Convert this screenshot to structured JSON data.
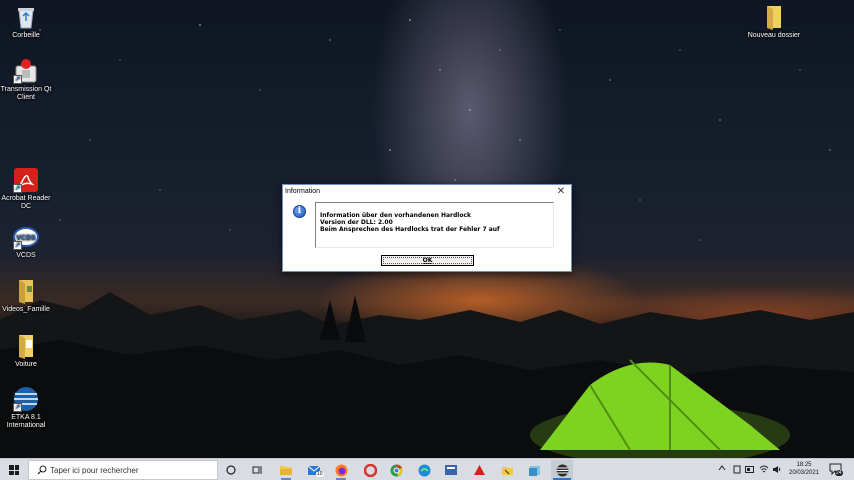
{
  "desktop": {
    "icons": [
      {
        "label": "Corbeille"
      },
      {
        "label": "Transmission Qt Client"
      },
      {
        "label": "Acrobat Reader DC"
      },
      {
        "label": "VCDS"
      },
      {
        "label": "Videos_Famille"
      },
      {
        "label": "Voiture"
      },
      {
        "label": "ETKA 8.1 International"
      },
      {
        "label": "Nouveau dossier"
      }
    ]
  },
  "dialog": {
    "title": "Information",
    "close_glyph": "✕",
    "info_glyph": "i",
    "message_lines": [
      "Information über den vorhandenen Hardlock",
      "Version der DLL: 2.00",
      "Beim Ansprechen des Hardlocks trat der Fehler 7 auf"
    ],
    "ok_label": "OK"
  },
  "taskbar": {
    "search_placeholder": "Taper ici pour rechercher",
    "mail_badge": "10",
    "time": "18:25",
    "date": "20/03/2021",
    "notification_count": "24",
    "icons": [
      "start-icon",
      "cortana-icon",
      "task-view-icon",
      "file-explorer-icon",
      "mail-icon",
      "firefox-icon",
      "ccleaner-icon",
      "chrome-icon",
      "edge-icon",
      "app-icon",
      "acrobat-icon",
      "folder-app-icon",
      "file-app-icon",
      "etka-icon"
    ]
  },
  "colors": {
    "accent": "#2b74d6",
    "dialog_border": "#6f8fbf",
    "taskbar": "#d9dde3"
  }
}
